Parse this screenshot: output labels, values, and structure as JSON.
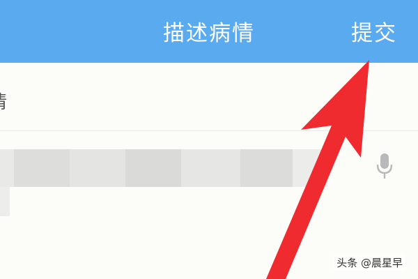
{
  "header": {
    "title": "描述病情",
    "submit_label": "提交"
  },
  "section": {
    "label": "情"
  },
  "watermark": {
    "text": "头条 @晨星早"
  },
  "icons": {
    "mic": "microphone-icon",
    "arrow": "arrow-annotation"
  },
  "colors": {
    "header_bg": "#5aaaf0",
    "header_text": "#ffffff",
    "arrow": "#ef2b2f",
    "background": "#fbfbf8"
  }
}
